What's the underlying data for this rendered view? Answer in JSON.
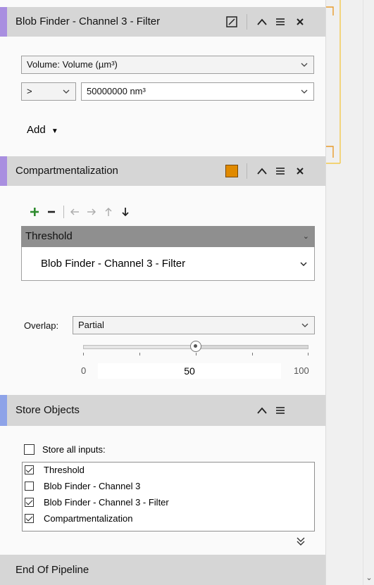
{
  "filter_panel": {
    "title": "Blob Finder - Channel 3 - Filter",
    "accent_color": "#a98fe0",
    "feature_select": "Volume: Volume (µm³)",
    "operator_select": ">",
    "value_select": "50000000 nm³",
    "add_label": "Add"
  },
  "compartment_panel": {
    "title": "Compartmentalization",
    "accent_color": "#a98fe0",
    "color_swatch": "#e08a00",
    "toolbar_icons": [
      "plus-icon",
      "minus-icon",
      "arrow-left-icon",
      "arrow-right-icon",
      "arrow-up-icon",
      "arrow-down-icon"
    ],
    "group_header": "Threshold",
    "group_item": "Blob Finder - Channel 3 - Filter",
    "overlap_label": "Overlap:",
    "overlap_value": "Partial",
    "slider": {
      "min": "0",
      "max": "100",
      "value": "50",
      "fraction": 0.5
    }
  },
  "store_panel": {
    "title": "Store Objects",
    "accent_color": "#8ea3e8",
    "store_all_label": "Store all inputs:",
    "store_all_checked": false,
    "items": [
      {
        "label": "Threshold",
        "checked": true
      },
      {
        "label": "Blob Finder - Channel 3",
        "checked": false
      },
      {
        "label": "Blob Finder - Channel 3 - Filter",
        "checked": true
      },
      {
        "label": "Compartmentalization",
        "checked": true
      }
    ]
  },
  "end_panel": {
    "title": "End Of Pipeline"
  },
  "colors": {
    "header_bg": "#d6d6d6",
    "connector_yellow": "#f2c94c",
    "connector_orange": "#e89a2a"
  }
}
